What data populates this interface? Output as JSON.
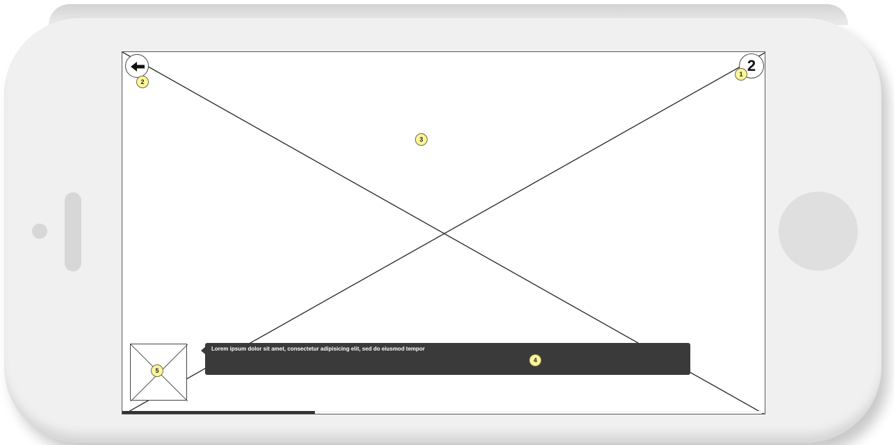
{
  "device": {
    "type": "phone-landscape",
    "body_color": "#f0f0f1"
  },
  "header": {
    "back_icon": "arrow-left-icon",
    "count_label": "2"
  },
  "markers": {
    "m1": "1",
    "m2": "2",
    "m3": "3",
    "m4": "4",
    "m5": "5"
  },
  "tooltip": {
    "text": "Lorem ipsum dolor sit amet, consectetur adipisicing elit, sed do eiusmod tempor"
  },
  "progress": {
    "value": 0.3
  },
  "colors": {
    "marker_fill": "#fbf59b",
    "tooltip_bg": "#3a3a3a",
    "progress_fill": "#333333"
  }
}
